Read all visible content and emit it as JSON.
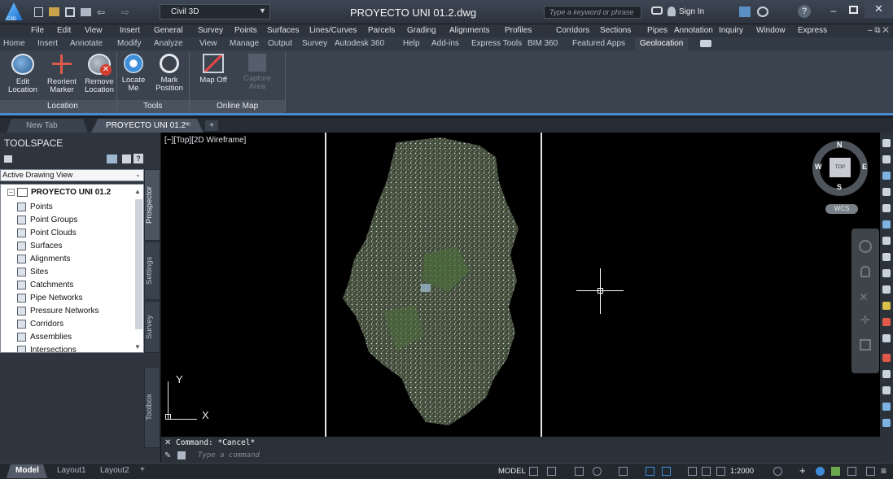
{
  "titlebar": {
    "app_badge": "C3D",
    "workspace": "Civil 3D",
    "document_title": "PROYECTO UNI 01.2.dwg",
    "search_placeholder": "Type a keyword or phrase",
    "sign_in": "Sign In"
  },
  "menubar": {
    "items": [
      "File",
      "Edit",
      "View",
      "Insert",
      "General",
      "Survey",
      "Points",
      "Surfaces",
      "Lines/Curves",
      "Parcels",
      "Grading",
      "Alignments",
      "Profiles",
      "Corridors",
      "Sections",
      "Pipes",
      "Annotation",
      "Inquiry",
      "Window",
      "Express"
    ]
  },
  "ribbon_tabs": [
    "Home",
    "Insert",
    "Annotate",
    "Modify",
    "Analyze",
    "View",
    "Manage",
    "Output",
    "Survey",
    "Autodesk 360",
    "Help",
    "Add-ins",
    "Express Tools",
    "BIM 360",
    "Featured Apps",
    "Geolocation"
  ],
  "ribbon": {
    "buttons": [
      {
        "label1": "Edit",
        "label2": "Location"
      },
      {
        "label1": "Reorient",
        "label2": "Marker"
      },
      {
        "label1": "Remove",
        "label2": "Location"
      },
      {
        "label1": "Locate",
        "label2": "Me"
      },
      {
        "label1": "Mark",
        "label2": "Position"
      },
      {
        "label1": "Map Off",
        "label2": ""
      },
      {
        "label1": "Capture",
        "label2": "Area"
      }
    ],
    "panels": [
      "Location",
      "Tools",
      "Online Map"
    ]
  },
  "doc_tabs": [
    "New Tab",
    "PROYECTO UNI 01.2*"
  ],
  "toolspace": {
    "title": "TOOLSPACE",
    "view_select": "Active Drawing View",
    "root": "PROYECTO UNI 01.2",
    "items": [
      "Points",
      "Point Groups",
      "Point Clouds",
      "Surfaces",
      "Alignments",
      "Sites",
      "Catchments",
      "Pipe Networks",
      "Pressure Networks",
      "Corridors",
      "Assemblies",
      "Intersections"
    ],
    "side_tabs": [
      "Prospector",
      "Settings",
      "Survey",
      "Toolbox"
    ]
  },
  "viewport": {
    "label": "[−][Top][2D Wireframe]",
    "viewcube": {
      "north": "N",
      "south": "S",
      "east": "E",
      "west": "W",
      "top": "TOP",
      "wcs": "WCS"
    },
    "ucs": {
      "x": "X",
      "y": "Y"
    }
  },
  "command": {
    "history": "Command: *Cancel*",
    "placeholder": "Type a command"
  },
  "layout_tabs": [
    "Model",
    "Layout1",
    "Layout2"
  ],
  "status": {
    "mode": "MODEL",
    "scale": "1:2000"
  },
  "colors": {
    "accent": "#4a8ad0",
    "ribbon_bg": "#3b434f",
    "viewport_bg": "#000000"
  }
}
